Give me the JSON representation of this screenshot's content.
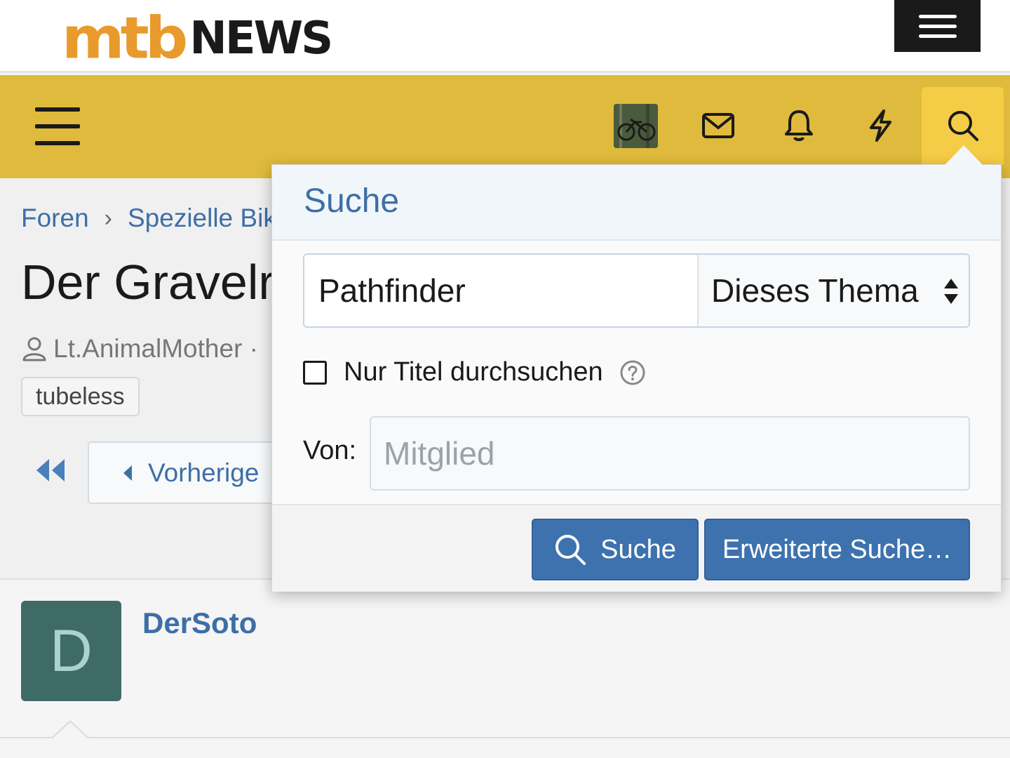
{
  "header": {
    "logo_mtb": "mtb",
    "logo_news": "NEWS",
    "brand_orange": "#e89a2c",
    "nav_yellow": "#dfba3c",
    "nav_search_active": "#f5cc45"
  },
  "nav": {
    "icons": [
      "hamburger-icon",
      "avatar",
      "envelope-icon",
      "bell-icon",
      "lightning-icon",
      "search-icon"
    ]
  },
  "page": {
    "breadcrumb": {
      "items": [
        "Foren",
        "Spezielle Bik"
      ]
    },
    "thread_title": "Der Gravelr",
    "author": "Lt.AnimalMother ·",
    "tag": "tubeless",
    "prev_label": "Vorherige",
    "post": {
      "avatar_letter": "D",
      "author": "DerSoto"
    }
  },
  "search_popup": {
    "title": "Suche",
    "query_value": "Pathfinder",
    "scope_selected": "Dieses Thema",
    "title_only_label": "Nur Titel durchsuchen",
    "title_only_checked": false,
    "von_label": "Von:",
    "member_placeholder": "Mitglied",
    "search_button": "Suche",
    "advanced_button": "Erweiterte Suche…",
    "link_color": "#3d6fa6",
    "button_color": "#3d72ae"
  }
}
